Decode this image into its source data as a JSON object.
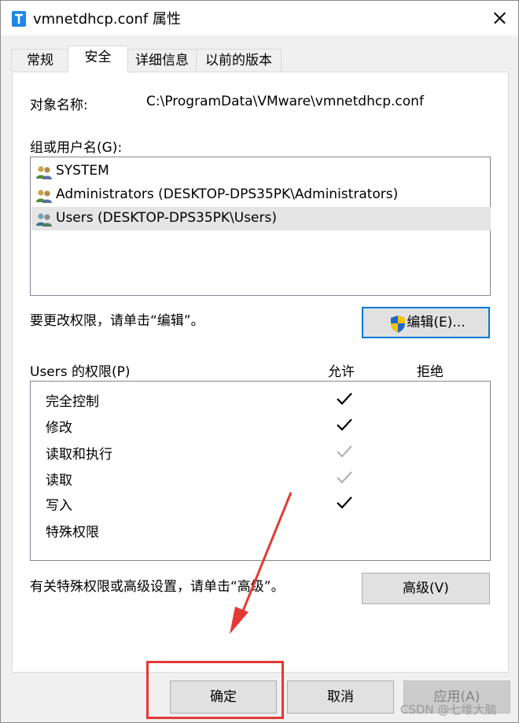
{
  "window": {
    "title": "vmnetdhcp.conf 属性",
    "close_icon": "close-icon",
    "file_icon": "text-file-icon",
    "accent": "#0078d7"
  },
  "tabs": [
    {
      "label": "常规",
      "active": false
    },
    {
      "label": "安全",
      "active": true
    },
    {
      "label": "详细信息",
      "active": false
    },
    {
      "label": "以前的版本",
      "active": false
    }
  ],
  "object": {
    "label": "对象名称:",
    "value": "C:\\ProgramData\\VMware\\vmnetdhcp.conf"
  },
  "groups": {
    "label": "组或用户名(G):",
    "items": [
      {
        "label": "SYSTEM",
        "icon": "user-group-icon",
        "selected": false
      },
      {
        "label": "Administrators (DESKTOP-DPS35PK\\Administrators)",
        "icon": "user-group-icon",
        "selected": false
      },
      {
        "label": "Users (DESKTOP-DPS35PK\\Users)",
        "icon": "user-group-icon",
        "selected": true
      }
    ]
  },
  "edit": {
    "hint": "要更改权限，请单击“编辑”。",
    "button_label": "编辑(E)...",
    "button_icon": "uac-shield-icon"
  },
  "permissions": {
    "label": "Users 的权限(P)",
    "allow_header": "允许",
    "deny_header": "拒绝",
    "rows": [
      {
        "name": "完全控制",
        "allow": "checked",
        "deny": ""
      },
      {
        "name": "修改",
        "allow": "checked",
        "deny": ""
      },
      {
        "name": "读取和执行",
        "allow": "inherited",
        "deny": ""
      },
      {
        "name": "读取",
        "allow": "inherited",
        "deny": ""
      },
      {
        "name": "写入",
        "allow": "checked",
        "deny": ""
      },
      {
        "name": "特殊权限",
        "allow": "",
        "deny": ""
      }
    ]
  },
  "advanced": {
    "hint": "有关特殊权限或高级设置，请单击“高级”。",
    "button_label": "高级(V)"
  },
  "footer": {
    "ok_label": "确定",
    "cancel_label": "取消",
    "apply_label": "应用(A)"
  },
  "annotation": {
    "highlight_color": "#e53935"
  },
  "watermark": "CSDN @七维大脑"
}
